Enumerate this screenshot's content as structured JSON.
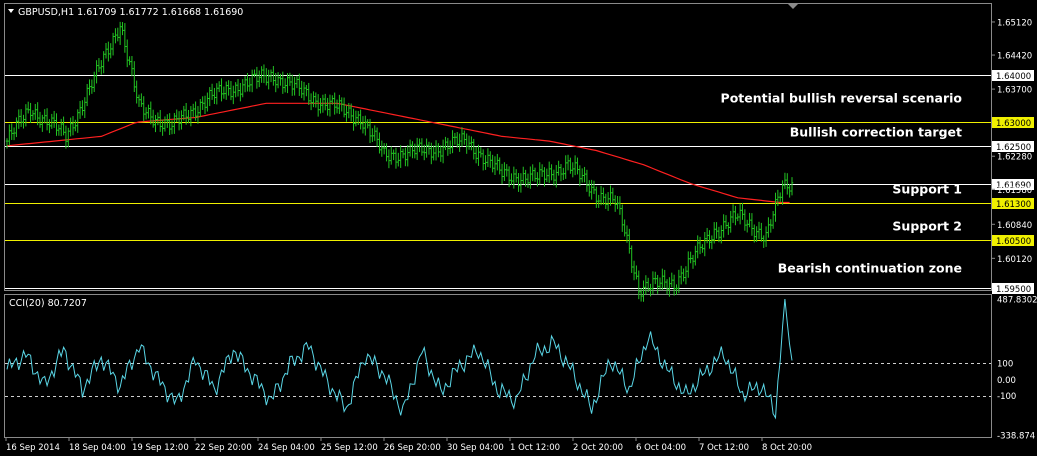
{
  "window": {
    "symbol_header": "GBPUSD,H1  1.61709 1.61772 1.61668 1.61690"
  },
  "colors": {
    "background": "#000000",
    "frame": "#8a8a8a",
    "candle": "#22c322",
    "ma": "#ff2020",
    "level_white": "#ffffff",
    "level_yellow": "#f0f000",
    "cci": "#5ad6e6",
    "text": "#ffffff"
  },
  "price_axis": {
    "ticks": [
      "1.65120",
      "1.64420",
      "1.63700",
      "1.62280",
      "1.61580",
      "1.60840",
      "1.60120"
    ]
  },
  "levels": [
    {
      "value": 1.64,
      "label": "1.64000",
      "color": "white",
      "note": ""
    },
    {
      "value": 1.63,
      "label": "1.63000",
      "color": "yellow",
      "note": "Potential bullish reversal scenario"
    },
    {
      "value": 1.625,
      "label": "1.62500",
      "color": "white",
      "note": "Bullish correction target"
    },
    {
      "value": 1.6169,
      "label": "1.61690",
      "color": "white",
      "note": ""
    },
    {
      "value": 1.613,
      "label": "1.61300",
      "color": "yellow",
      "note": "Support 1"
    },
    {
      "value": 1.605,
      "label": "1.60500",
      "color": "yellow",
      "note": "Support 2"
    },
    {
      "value": 1.595,
      "label": "1.59500",
      "color": "white",
      "note": "Bearish continuation zone"
    }
  ],
  "time_axis": {
    "labels": [
      "16 Sep 2014",
      "18 Sep 04:00",
      "19 Sep 12:00",
      "22 Sep 20:00",
      "24 Sep 04:00",
      "25 Sep 12:00",
      "26 Sep 20:00",
      "30 Sep 04:00",
      "1 Oct 12:00",
      "2 Oct 20:00",
      "6 Oct 04:00",
      "7 Oct 12:00",
      "8 Oct 20:00"
    ]
  },
  "cci_panel": {
    "header": "CCI(20) 80.7207",
    "ticks": [
      "487.8302",
      "100",
      "0.00",
      "-100",
      "-338.874"
    ]
  },
  "chart_data": [
    {
      "type": "line",
      "title": "GBPUSD,H1",
      "description": "H1 price candles (green) with red moving average and horizontal levels",
      "x_unit": "bar index (H1), 0 = 16 Sep 2014",
      "price_path": {
        "x": [
          0,
          10,
          25,
          38,
          48,
          56,
          70,
          85,
          100,
          113,
          130,
          150,
          160,
          178,
          195,
          210,
          225,
          238,
          250,
          258,
          262,
          268,
          283,
          300,
          310,
          322,
          329,
          333
        ],
        "y": [
          1.626,
          1.633,
          1.627,
          1.64,
          1.651,
          1.633,
          1.629,
          1.635,
          1.638,
          1.64,
          1.635,
          1.631,
          1.623,
          1.624,
          1.626,
          1.619,
          1.618,
          1.621,
          1.615,
          1.613,
          1.607,
          1.595,
          1.596,
          1.607,
          1.61,
          1.606,
          1.616,
          1.617
        ]
      },
      "moving_average": {
        "x": [
          0,
          40,
          55,
          80,
          110,
          140,
          160,
          190,
          210,
          230,
          250,
          270,
          290,
          310,
          328,
          333
        ],
        "y": [
          1.625,
          1.627,
          1.63,
          1.631,
          1.634,
          1.634,
          1.632,
          1.629,
          1.627,
          1.626,
          1.624,
          1.621,
          1.617,
          1.614,
          1.613,
          1.613
        ]
      },
      "ylim": [
        1.5945,
        1.655
      ],
      "xlim": [
        0,
        333
      ]
    },
    {
      "type": "line",
      "title": "CCI(20) 80.7207",
      "reference_lines": [
        100,
        -100
      ],
      "x": [
        0,
        8,
        16,
        24,
        32,
        40,
        48,
        56,
        64,
        72,
        80,
        88,
        96,
        104,
        112,
        120,
        128,
        136,
        144,
        152,
        160,
        168,
        176,
        184,
        192,
        200,
        208,
        216,
        224,
        232,
        240,
        248,
        256,
        264,
        272,
        280,
        288,
        296,
        304,
        312,
        320,
        326,
        330,
        333
      ],
      "y": [
        60,
        150,
        -40,
        180,
        -60,
        130,
        -40,
        200,
        0,
        -150,
        120,
        -60,
        180,
        20,
        -130,
        90,
        200,
        -20,
        -180,
        150,
        30,
        -200,
        170,
        -80,
        80,
        180,
        -60,
        -130,
        150,
        220,
        40,
        -180,
        120,
        -60,
        260,
        60,
        -100,
        40,
        160,
        -90,
        -40,
        -200,
        487,
        100
      ],
      "ylim": [
        -338.874,
        487.8302
      ],
      "xlim": [
        0,
        333
      ]
    }
  ]
}
